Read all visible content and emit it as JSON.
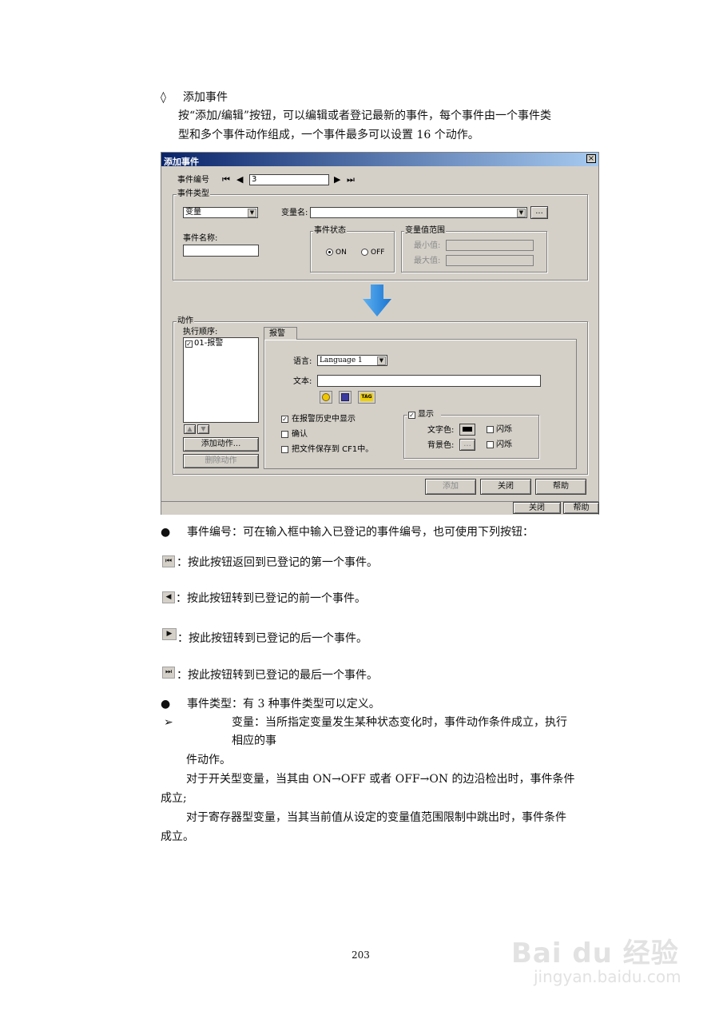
{
  "intro": {
    "heading_bullet": "◊",
    "heading": "添加事件",
    "para_line1": "按“添加/编辑”按钮，可以编辑或者登记最新的事件，每个事件由一个事件类",
    "para_line2": "型和多个事件动作组成，一个事件最多可以设置 16 个动作。"
  },
  "dialog": {
    "title": "添加事件",
    "close_glyph": "×",
    "event_number_label": "事件编号",
    "event_number_value": "3",
    "event_type_group": "事件类型",
    "event_type_value": "变量",
    "variable_name_label": "变量名:",
    "browse_button": "...",
    "event_name_label": "事件名称:",
    "event_state_group": "事件状态",
    "on_label": "ON",
    "off_label": "OFF",
    "range_group": "变量值范围",
    "min_label": "最小值:",
    "max_label": "最大值:",
    "action_group": "动作",
    "exec_order_label": "执行顺序:",
    "action_item": "01-报警",
    "add_action_button": "添加动作...",
    "delete_action_button": "删除动作",
    "tab_alarm": "报警",
    "language_label": "语言:",
    "language_value": "Language 1",
    "text_label": "文本:",
    "tag_icon_text": "TAG",
    "show_in_history": "在报警历史中显示",
    "confirm": "确认",
    "save_to_cf": "把文件保存到 CF1中。",
    "display_group": "显示",
    "text_color_label": "文字色:",
    "bg_color_label": "背景色:",
    "blink_label": "闪烁",
    "add_button": "添加",
    "close_button": "关闭",
    "help_button": "帮助"
  },
  "outer_bar": {
    "close_button": "关闭",
    "help_button": "帮助"
  },
  "body": {
    "bullet": "●",
    "event_number_desc": "事件编号：可在输入框中输入已登记的事件编号，也可使用下列按钮：",
    "first_desc": "：按此按钮返回到已登记的第一个事件。",
    "prev_desc": "：按此按钮转到已登记的前一个事件。",
    "next_desc": "：按此按钮转到已登记的后一个事件。",
    "last_desc": "：按此按钮转到已登记的最后一个事件。",
    "event_type_desc": "事件类型：有 3 种事件类型可以定义。",
    "arrow_bullet": "➢",
    "var_line1": "变量：当所指定变量发生某种状态变化时，事件动作条件成立，执行",
    "var_line2": "相应的事",
    "var_line3": "件动作。",
    "switch_line1": "对于开关型变量，当其由 ON→OFF 或者 OFF→ON 的边沿检出时，事件条件",
    "switch_line2": "成立;",
    "register_line1": "对于寄存器型变量，当其当前值从设定的变量值范围限制中跳出时，事件条件",
    "register_line2": "成立。"
  },
  "page_number": "203",
  "watermark": {
    "logo": "Bai du 经验",
    "url": "jingyan.baidu.com"
  }
}
